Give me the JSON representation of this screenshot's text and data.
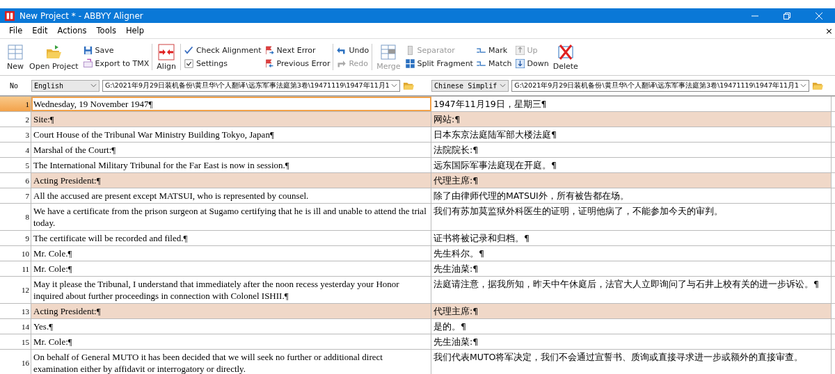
{
  "window": {
    "title": "New Project * - ABBYY Aligner"
  },
  "menu": {
    "items": [
      "File",
      "Edit",
      "Actions",
      "Tools",
      "Help"
    ],
    "mdi_close": "×"
  },
  "toolbar": [
    {
      "kind": "big",
      "buttons": [
        {
          "label": "New",
          "disabled": false
        }
      ]
    },
    {
      "kind": "big",
      "buttons": [
        {
          "label": "Open Project",
          "disabled": false
        }
      ]
    },
    {
      "kind": "stack",
      "buttons": [
        {
          "label": "Save",
          "disabled": false
        },
        {
          "label": "Export to TMX",
          "disabled": false
        }
      ]
    },
    {
      "kind": "sep"
    },
    {
      "kind": "big",
      "buttons": [
        {
          "label": "Align",
          "disabled": false
        }
      ]
    },
    {
      "kind": "sep"
    },
    {
      "kind": "stack",
      "buttons": [
        {
          "label": "Check Alignment",
          "disabled": false
        },
        {
          "label": "Settings",
          "disabled": false
        }
      ]
    },
    {
      "kind": "stack",
      "buttons": [
        {
          "label": "Next Error",
          "disabled": false
        },
        {
          "label": "Previous Error",
          "disabled": false
        }
      ]
    },
    {
      "kind": "sep"
    },
    {
      "kind": "stack",
      "buttons": [
        {
          "label": "Undo",
          "disabled": false
        },
        {
          "label": "Redo",
          "disabled": true
        }
      ]
    },
    {
      "kind": "sep"
    },
    {
      "kind": "big",
      "buttons": [
        {
          "label": "Merge",
          "disabled": true
        }
      ]
    },
    {
      "kind": "stack",
      "buttons": [
        {
          "label": "Separator",
          "disabled": true
        },
        {
          "label": "Split Fragment",
          "disabled": false
        }
      ]
    },
    {
      "kind": "stack",
      "buttons": [
        {
          "label": "Mark",
          "disabled": false
        },
        {
          "label": "Match",
          "disabled": false
        }
      ]
    },
    {
      "kind": "stack",
      "buttons": [
        {
          "label": "Up",
          "disabled": true
        },
        {
          "label": "Down",
          "disabled": false
        }
      ]
    },
    {
      "kind": "big",
      "buttons": [
        {
          "label": "Delete",
          "disabled": false
        }
      ]
    }
  ],
  "languages": {
    "number_heading": "No",
    "left": {
      "language": "English",
      "path": "G:\\2021年9月29日装机备份\\黄旦华\\个人翻译\\远东军事法庭第3卷\\19471119\\1947年11月1"
    },
    "right": {
      "language": "Chinese Simplif",
      "path": "G:\\2021年9月29日装机备份\\黄旦华\\个人翻译\\远东军事法庭第3卷\\19471119\\1947年11月1"
    }
  },
  "rows": [
    {
      "number": "1",
      "source": "Wednesday, 19 November 1947¶",
      "target": "1947年11月19日，星期三¶",
      "highlighted": false,
      "selected": true
    },
    {
      "number": "2",
      "source": "Site:¶",
      "target": "网站:¶",
      "highlighted": true,
      "selected": false
    },
    {
      "number": "3",
      "source": "Court House of the Tribunal War Ministry Building Tokyo, Japan¶",
      "target": "日本东京法庭陆军部大楼法庭¶",
      "highlighted": false,
      "selected": false
    },
    {
      "number": "4",
      "source": "Marshal of the Court:¶",
      "target": "法院院长:¶",
      "highlighted": false,
      "selected": false
    },
    {
      "number": "5",
      "source": "The International Military Tribunal for the Far East is now in session.¶",
      "target": "远东国际军事法庭现在开庭。¶",
      "highlighted": false,
      "selected": false
    },
    {
      "number": "6",
      "source": "Acting President:¶",
      "target": "代理主席:¶",
      "highlighted": true,
      "selected": false
    },
    {
      "number": "7",
      "source": "All the accused are present except MATSUI, who is represented by counsel.",
      "target": "除了由律师代理的MATSUI外，所有被告都在场。",
      "highlighted": false,
      "selected": false
    },
    {
      "number": "8",
      "source": "We have a certificate from the prison surgeon at Sugamo certifying that he is ill and unable to attend the trial today.",
      "target": "我们有苏加莫监狱外科医生的证明，证明他病了，不能参加今天的审判。",
      "highlighted": false,
      "selected": false
    },
    {
      "number": "9",
      "source": "The certificate will be recorded and filed.¶",
      "target": "证书将被记录和归档。¶",
      "highlighted": false,
      "selected": false
    },
    {
      "number": "10",
      "source": "Mr. Cole.¶",
      "target": "先生科尔。¶",
      "highlighted": false,
      "selected": false
    },
    {
      "number": "11",
      "source": "Mr. Cole:¶",
      "target": "先生油菜:¶",
      "highlighted": false,
      "selected": false
    },
    {
      "number": "12",
      "source": "May it please the Tribunal, I understand that immediately after the noon recess yesterday your Honor inquired about further proceedings in connection with Colonel ISHII.¶",
      "target": "法庭请注意，据我所知，昨天中午休庭后，法官大人立即询问了与石井上校有关的进一步诉讼。¶",
      "highlighted": false,
      "selected": false
    },
    {
      "number": "13",
      "source": "Acting President:¶",
      "target": "代理主席:¶",
      "highlighted": true,
      "selected": false
    },
    {
      "number": "14",
      "source": "Yes.¶",
      "target": "是的。¶",
      "highlighted": false,
      "selected": false
    },
    {
      "number": "15",
      "source": "Mr. Cole:¶",
      "target": "先生油菜:¶",
      "highlighted": false,
      "selected": false
    },
    {
      "number": "16",
      "source": "On behalf of General MUTO it has been decided that we will seek no further or additional direct examination either by affidavit or interrogatory or directly.",
      "target": "我们代表MUTO将军决定，我们不会通过宣誓书、质询或直接寻求进一步或额外的直接审查。",
      "highlighted": false,
      "selected": false
    }
  ]
}
